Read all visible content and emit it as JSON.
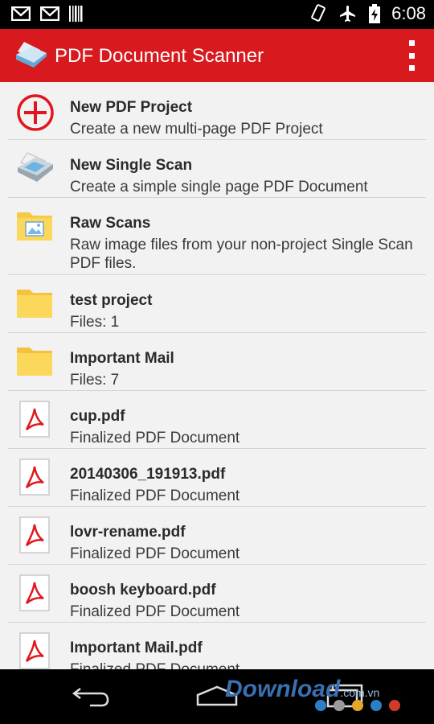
{
  "status_bar": {
    "time": "6:08",
    "icons": [
      "gmail-icon",
      "gmail-icon",
      "barcode-icon",
      "rotate-icon",
      "airplane-icon",
      "battery-charging-icon"
    ]
  },
  "app_bar": {
    "title": "PDF Document Scanner",
    "color": "#d8191e"
  },
  "items": [
    {
      "title": "New PDF Project",
      "subtitle": "Create a new multi-page PDF Project",
      "icon": "add-circle-icon"
    },
    {
      "title": "New Single Scan",
      "subtitle": "Create a simple single page PDF Document",
      "icon": "scanner-icon"
    },
    {
      "title": "Raw Scans",
      "subtitle": "Raw image files from your non-project Single Scan PDF files.",
      "icon": "image-folder-icon"
    },
    {
      "title": "test project",
      "subtitle": "Files: 1",
      "icon": "folder-icon"
    },
    {
      "title": "Important Mail",
      "subtitle": "Files: 7",
      "icon": "folder-icon"
    },
    {
      "title": "cup.pdf",
      "subtitle": "Finalized PDF Document",
      "icon": "pdf-file-icon"
    },
    {
      "title": "20140306_191913.pdf",
      "subtitle": "Finalized PDF Document",
      "icon": "pdf-file-icon"
    },
    {
      "title": "lovr-rename.pdf",
      "subtitle": "Finalized PDF Document",
      "icon": "pdf-file-icon"
    },
    {
      "title": "boosh keyboard.pdf",
      "subtitle": "Finalized PDF Document",
      "icon": "pdf-file-icon"
    },
    {
      "title": "Important Mail.pdf",
      "subtitle": "Finalized PDF Document",
      "icon": "pdf-file-icon"
    }
  ],
  "watermark": {
    "main": "Download",
    "suffix": ".com.vn"
  }
}
